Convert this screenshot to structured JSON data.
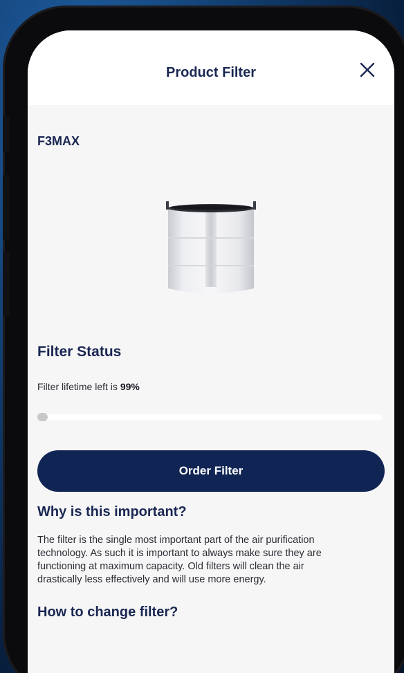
{
  "header": {
    "title": "Product Filter",
    "close_icon": "close-icon"
  },
  "product": {
    "model": "F3MAX",
    "image": "filter-cylinder-image"
  },
  "status": {
    "title": "Filter Status",
    "lifetime_prefix": "Filter lifetime left is",
    "lifetime_value": "99%",
    "lifetime_fraction": 0.99
  },
  "actions": {
    "order_label": "Order Filter"
  },
  "info": {
    "why_title": "Why is this important?",
    "why_text": "The filter is the single most important part of the air purification technology. As such it is important to always make sure they are functioning at maximum capacity. Old filters will clean the air drastically less effectively and will use more energy.",
    "how_title": "How to change filter?"
  },
  "colors": {
    "primary": "#102554",
    "title_text": "#1a2752",
    "screen_bg": "#f6f6f7"
  }
}
